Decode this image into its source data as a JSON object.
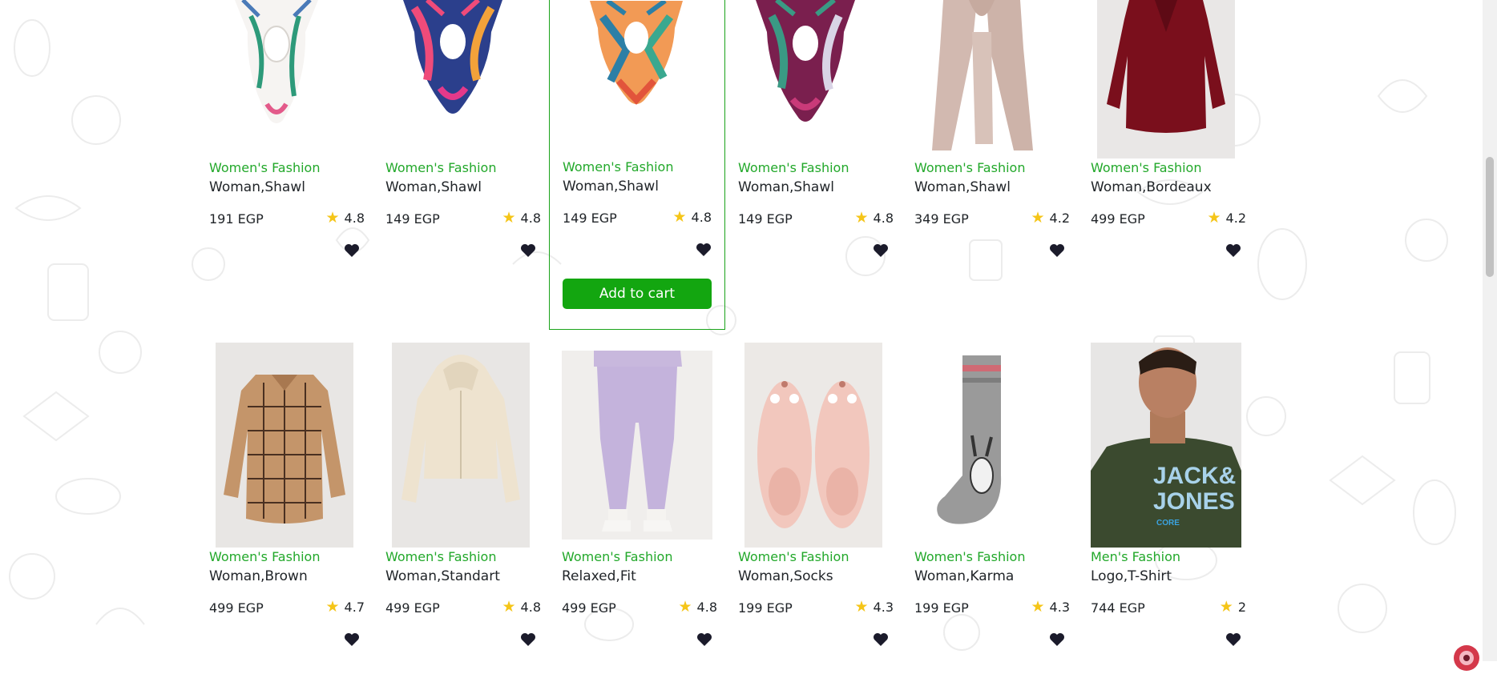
{
  "products": [
    {
      "category": "Women's Fashion",
      "title": "Woman,Shawl",
      "price": "191 EGP",
      "rating": "4.8",
      "image": "floral-white-scarf"
    },
    {
      "category": "Women's Fashion",
      "title": "Woman,Shawl",
      "price": "149 EGP",
      "rating": "4.8",
      "image": "colorful-scarf"
    },
    {
      "category": "Women's Fashion",
      "title": "Woman,Shawl",
      "price": "149 EGP",
      "rating": "4.8",
      "image": "geometric-scarf",
      "add_to_cart": "Add to cart"
    },
    {
      "category": "Women's Fashion",
      "title": "Woman,Shawl",
      "price": "149 EGP",
      "rating": "4.8",
      "image": "purple-scarf"
    },
    {
      "category": "Women's Fashion",
      "title": "Woman,Shawl",
      "price": "349 EGP",
      "rating": "4.2",
      "image": "beige-long-scarf"
    },
    {
      "category": "Women's Fashion",
      "title": "Woman,Bordeaux",
      "price": "499 EGP",
      "rating": "4.2",
      "image": "bordeaux-blouse"
    },
    {
      "category": "Women's Fashion",
      "title": "Woman,Brown",
      "price": "499 EGP",
      "rating": "4.7",
      "image": "brown-plaid-shirt"
    },
    {
      "category": "Women's Fashion",
      "title": "Woman,Standart",
      "price": "499 EGP",
      "rating": "4.8",
      "image": "cream-hoodie"
    },
    {
      "category": "Women's Fashion",
      "title": "Relaxed,Fit",
      "price": "499 EGP",
      "rating": "4.8",
      "image": "lilac-joggers"
    },
    {
      "category": "Women's Fashion",
      "title": "Woman,Socks",
      "price": "199 EGP",
      "rating": "4.3",
      "image": "pink-slipper-socks"
    },
    {
      "category": "Women's Fashion",
      "title": "Woman,Karma",
      "price": "199 EGP",
      "rating": "4.3",
      "image": "grey-bunny-sock"
    },
    {
      "category": "Men's Fashion",
      "title": "Logo,T-Shirt",
      "price": "744 EGP",
      "rating": "2",
      "image": "jack-jones-tshirt",
      "image_text": "JACK&\nJONES",
      "image_subtext": "CORE"
    }
  ],
  "colors": {
    "category_green": "#22a82a",
    "button_green": "#13a610",
    "star_yellow": "#f5c518",
    "heart": "#1b1b2b"
  },
  "icons": {
    "rating": "star-icon",
    "wishlist": "heart-icon"
  }
}
